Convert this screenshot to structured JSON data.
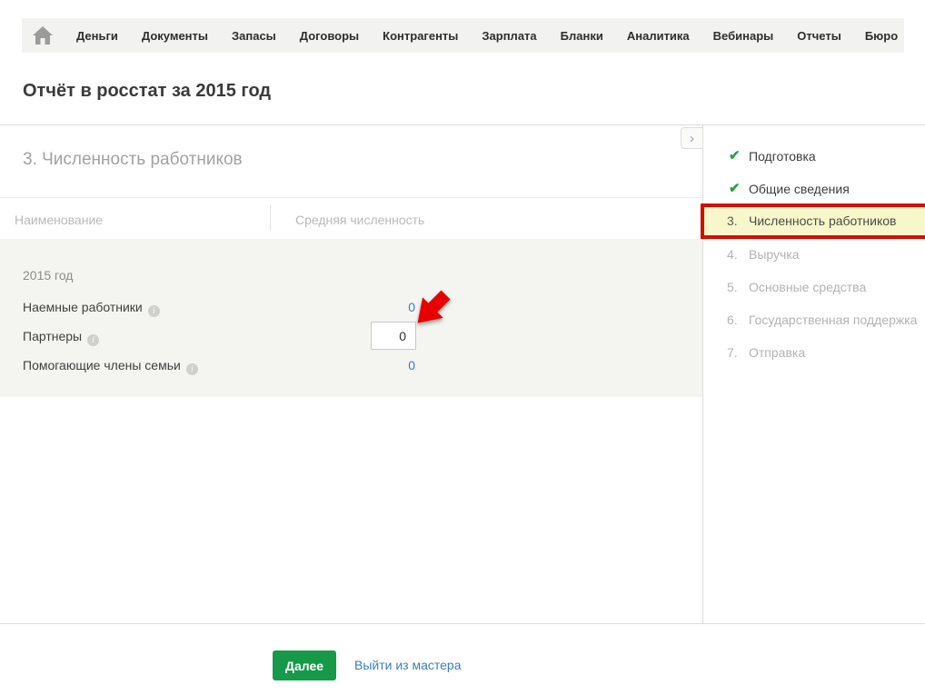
{
  "nav": {
    "items": [
      "Деньги",
      "Документы",
      "Запасы",
      "Договоры",
      "Контрагенты",
      "Зарплата",
      "Бланки",
      "Аналитика",
      "Вебинары",
      "Отчеты",
      "Бюро"
    ]
  },
  "page": {
    "title": "Отчёт в росстат за 2015 год"
  },
  "wizard": {
    "section_title": "3. Численность работников",
    "collapse_glyph": "›",
    "table": {
      "columns": [
        "Наименование",
        "Средняя численность"
      ],
      "group_label": "2015 год",
      "rows": [
        {
          "label": "Наемные работники",
          "value": "0"
        },
        {
          "label": "Партнеры",
          "value": "0"
        },
        {
          "label": "Помогающие члены семьи",
          "value": "0"
        }
      ],
      "info_glyph": "i"
    },
    "steps": [
      {
        "label": "Подготовка",
        "state": "done",
        "check": "✔"
      },
      {
        "label": "Общие сведения",
        "state": "done",
        "check": "✔"
      },
      {
        "num": "3.",
        "label": "Численность работников",
        "state": "current"
      },
      {
        "num": "4.",
        "label": "Выручка",
        "state": "pending"
      },
      {
        "num": "5.",
        "label": "Основные средства",
        "state": "pending"
      },
      {
        "num": "6.",
        "label": "Государственная поддержка",
        "state": "pending"
      },
      {
        "num": "7.",
        "label": "Отправка",
        "state": "pending"
      }
    ],
    "footer": {
      "next_label": "Далее",
      "exit_label": "Выйти из мастера"
    }
  },
  "colors": {
    "nav_bg": "#f2f2f0",
    "accent_green": "#169a4a",
    "check_green": "#27a244",
    "link_blue": "#3a7bbf",
    "current_step_bg": "#f8f7ca",
    "annotation_red": "#d40d00",
    "table_body_bg": "#f4f4f1"
  }
}
